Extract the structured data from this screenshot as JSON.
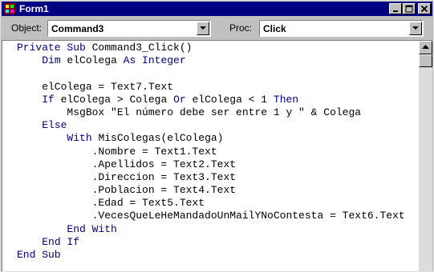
{
  "window": {
    "title": "Form1"
  },
  "toolbar": {
    "object_label": "Object:",
    "object_value": "Command3",
    "proc_label": "Proc:",
    "proc_value": "Click"
  },
  "colors": {
    "titlebar": "#000080",
    "keyword": "#000080",
    "text": "#000000",
    "editor_bg": "#ffffff",
    "face": "#c0c0c0"
  },
  "icons": [
    "app-icon",
    "minimize-icon",
    "maximize-icon",
    "close-icon",
    "dropdown-arrow-icon",
    "scroll-up-icon"
  ],
  "code": [
    [
      {
        "t": "Private Sub",
        "k": true
      },
      {
        "t": " Command3_Click()"
      }
    ],
    [
      {
        "t": "    "
      },
      {
        "t": "Dim",
        "k": true
      },
      {
        "t": " elColega "
      },
      {
        "t": "As Integer",
        "k": true
      }
    ],
    [
      {
        "t": ""
      }
    ],
    [
      {
        "t": "    elColega = Text7.Text"
      }
    ],
    [
      {
        "t": "    "
      },
      {
        "t": "If",
        "k": true
      },
      {
        "t": " elColega > Colega "
      },
      {
        "t": "Or",
        "k": true
      },
      {
        "t": " elColega < 1 "
      },
      {
        "t": "Then",
        "k": true
      }
    ],
    [
      {
        "t": "        MsgBox \"El número debe ser entre 1 y \" & Colega"
      }
    ],
    [
      {
        "t": "    "
      },
      {
        "t": "Else",
        "k": true
      }
    ],
    [
      {
        "t": "        "
      },
      {
        "t": "With",
        "k": true
      },
      {
        "t": " MisColegas(elColega)"
      }
    ],
    [
      {
        "t": "            .Nombre = Text1.Text"
      }
    ],
    [
      {
        "t": "            .Apellidos = Text2.Text"
      }
    ],
    [
      {
        "t": "            .Direccion = Text3.Text"
      }
    ],
    [
      {
        "t": "            .Poblacion = Text4.Text"
      }
    ],
    [
      {
        "t": "            .Edad = Text5.Text"
      }
    ],
    [
      {
        "t": "            .VecesQueLeHeMandadoUnMailYNoContesta = Text6.Text"
      }
    ],
    [
      {
        "t": "        "
      },
      {
        "t": "End With",
        "k": true
      }
    ],
    [
      {
        "t": "    "
      },
      {
        "t": "End If",
        "k": true
      }
    ],
    [
      {
        "t": "End Sub",
        "k": true
      }
    ]
  ]
}
